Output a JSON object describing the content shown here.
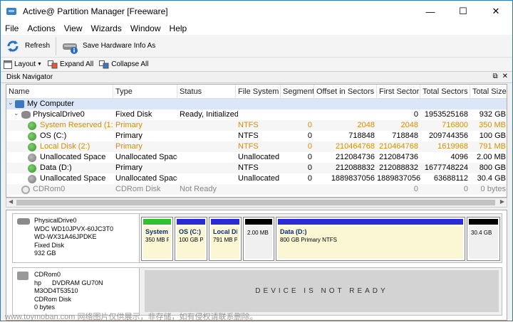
{
  "window": {
    "title": "Active@ Partition Manager [Freeware]",
    "controls": [
      "—",
      "☐",
      "✕"
    ]
  },
  "menu": [
    "File",
    "Actions",
    "View",
    "Wizards",
    "Window",
    "Help"
  ],
  "toolbar": {
    "refresh": "Refresh",
    "save_hw": "Save Hardware Info As"
  },
  "toolbar2": {
    "layout": "Layout",
    "expand": "Expand All",
    "collapse": "Collapse All"
  },
  "panel": {
    "title": "Disk Navigator",
    "pin": "⧉",
    "close": "✕"
  },
  "columns": [
    "Name",
    "Type",
    "Status",
    "File System",
    "Segment",
    "Offset in Sectors",
    "First Sector",
    "Total Sectors",
    "Total Size"
  ],
  "rows": [
    {
      "name": "My Computer",
      "type": "",
      "status": "",
      "fs": "",
      "segment": "",
      "offset": "",
      "first": "",
      "total_sectors": "",
      "size": ""
    },
    {
      "name": "PhysicalDrive0",
      "type": "Fixed Disk",
      "status": "Ready, Initialized",
      "fs": "",
      "segment": "",
      "offset": "",
      "first": "0",
      "total_sectors": "1953525168",
      "size": "932 GB"
    },
    {
      "name": "System Reserved (1:)",
      "type": "Primary",
      "status": "",
      "fs": "NTFS",
      "segment": "0",
      "offset": "2048",
      "first": "2048",
      "total_sectors": "716800",
      "size": "350 MB"
    },
    {
      "name": "OS (C:)",
      "type": "Primary",
      "status": "",
      "fs": "NTFS",
      "segment": "0",
      "offset": "718848",
      "first": "718848",
      "total_sectors": "209744356",
      "size": "100 GB"
    },
    {
      "name": "Local Disk (2:)",
      "type": "Primary",
      "status": "",
      "fs": "NTFS",
      "segment": "0",
      "offset": "210464768",
      "first": "210464768",
      "total_sectors": "1619968",
      "size": "791 MB"
    },
    {
      "name": "Unallocated Space",
      "type": "Unallocated Space",
      "status": "",
      "fs": "Unallocated",
      "segment": "0",
      "offset": "212084736",
      "first": "212084736",
      "total_sectors": "4096",
      "size": "2.00 MB"
    },
    {
      "name": "Data (D:)",
      "type": "Primary",
      "status": "",
      "fs": "NTFS",
      "segment": "0",
      "offset": "212088832",
      "first": "212088832",
      "total_sectors": "1677748224",
      "size": "800 GB"
    },
    {
      "name": "Unallocated Space",
      "type": "Unallocated Space",
      "status": "",
      "fs": "Unallocated",
      "segment": "0",
      "offset": "1889837056",
      "first": "1889837056",
      "total_sectors": "63688112",
      "size": "30.4 GB"
    },
    {
      "name": "CDRom0",
      "type": "CDRom Disk",
      "status": "Not Ready",
      "fs": "",
      "segment": "",
      "offset": "",
      "first": "0",
      "total_sectors": "0",
      "size": "0 bytes"
    }
  ],
  "disk0": {
    "lines": [
      "PhysicalDrive0",
      "WDC WD10JPVX-60JC3T0",
      "WD-WX31A46JPDKE",
      "Fixed Disk",
      "932 GB"
    ],
    "segments": [
      {
        "title": "System",
        "desc": "350 MB P",
        "color": "#2ec22e"
      },
      {
        "title": "OS (C:)",
        "desc": "100 GB P",
        "color": "#2b2bd6"
      },
      {
        "title": "Local Dis",
        "desc": "791 MB P",
        "color": "#2b2bd6"
      },
      {
        "title": "",
        "desc": "2.00 MB",
        "color": "#000000"
      },
      {
        "title": "Data (D:)",
        "desc": "800 GB Primary NTFS",
        "color": "#2b2bd6"
      },
      {
        "title": "",
        "desc": "30.4 GB",
        "color": "#000000"
      }
    ]
  },
  "cdrom": {
    "lines": [
      "CDRom0",
      "hp      DVDRAM GU70N",
      "M3OD4T53510",
      "CDRom Disk",
      "0 bytes"
    ],
    "status": "DEVICE IS NOT READY"
  },
  "watermark": "www.toymoban.com 网络图片仅供展示，非存储，如有侵权请联系删除。"
}
